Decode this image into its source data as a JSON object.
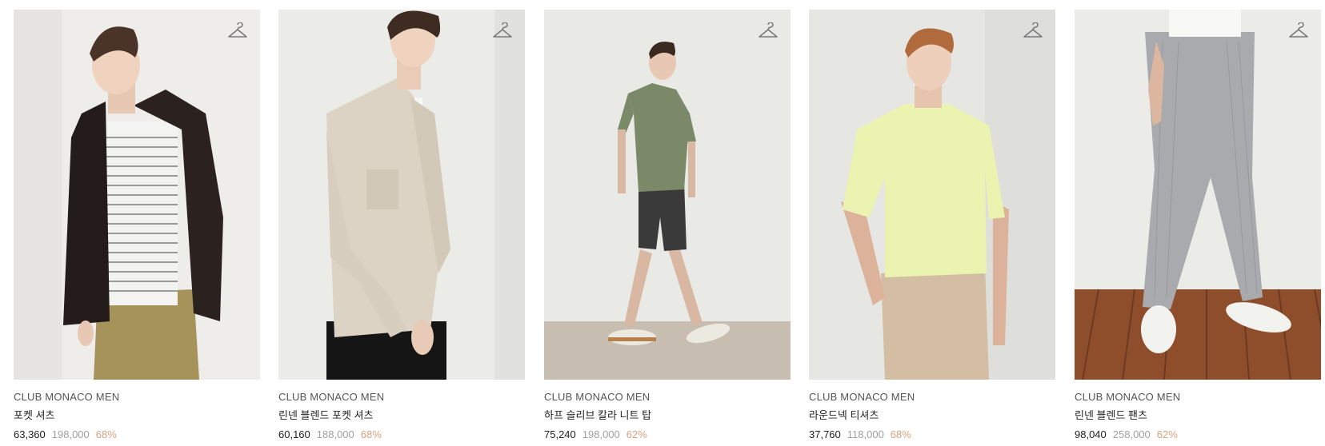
{
  "products": [
    {
      "brand": "CLUB MONACO MEN",
      "name": "포켓 셔츠",
      "price": "63,360",
      "original_price": "198,000",
      "discount": "68%",
      "image": "model-black-overshirt-photo"
    },
    {
      "brand": "CLUB MONACO MEN",
      "name": "린넨 블렌드 포켓 셔츠",
      "price": "60,160",
      "original_price": "188,000",
      "discount": "68%",
      "image": "model-beige-linen-shirt-photo"
    },
    {
      "brand": "CLUB MONACO MEN",
      "name": "하프 슬리브 칼라 니트 탑",
      "price": "75,240",
      "original_price": "198,000",
      "discount": "62%",
      "image": "model-green-knit-polo-photo"
    },
    {
      "brand": "CLUB MONACO MEN",
      "name": "라운드넥 티셔츠",
      "price": "37,760",
      "original_price": "118,000",
      "discount": "68%",
      "image": "model-lime-tshirt-photo"
    },
    {
      "brand": "CLUB MONACO MEN",
      "name": "린넨 블렌드 팬츠",
      "price": "98,040",
      "original_price": "258,000",
      "discount": "62%",
      "image": "model-grey-linen-pants-photo"
    }
  ],
  "icons": {
    "wishlist": "hanger-icon"
  },
  "colors": {
    "price": "#222222",
    "original_price": "#a0a0a0",
    "discount": "#d6a37e"
  }
}
